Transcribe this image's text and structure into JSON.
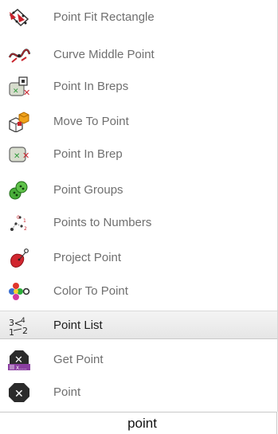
{
  "items": [
    {
      "label": "Point Fit Rectangle",
      "icon": "point-fit-rectangle-icon"
    },
    {
      "label": "Curve Middle Point",
      "icon": "curve-middle-point-icon"
    },
    {
      "label": "Point In Breps",
      "icon": "point-in-breps-icon"
    },
    {
      "label": "Move To Point",
      "icon": "move-to-point-icon"
    },
    {
      "label": "Point In Brep",
      "icon": "point-in-brep-icon"
    },
    {
      "label": "Point Groups",
      "icon": "point-groups-icon"
    },
    {
      "label": "Points to Numbers",
      "icon": "points-to-numbers-icon"
    },
    {
      "label": "Project Point",
      "icon": "project-point-icon"
    },
    {
      "label": "Color To Point",
      "icon": "color-to-point-icon"
    },
    {
      "label": "Point List",
      "icon": "point-list-icon",
      "highlighted": true
    },
    {
      "label": "Get Point",
      "icon": "get-point-icon"
    },
    {
      "label": "Point",
      "icon": "point-icon"
    }
  ],
  "search": {
    "value": "point"
  },
  "colors": {
    "highlight": "#e9e9e9",
    "label": "#6f6f6f",
    "highlight_label": "#1e1e1e"
  }
}
